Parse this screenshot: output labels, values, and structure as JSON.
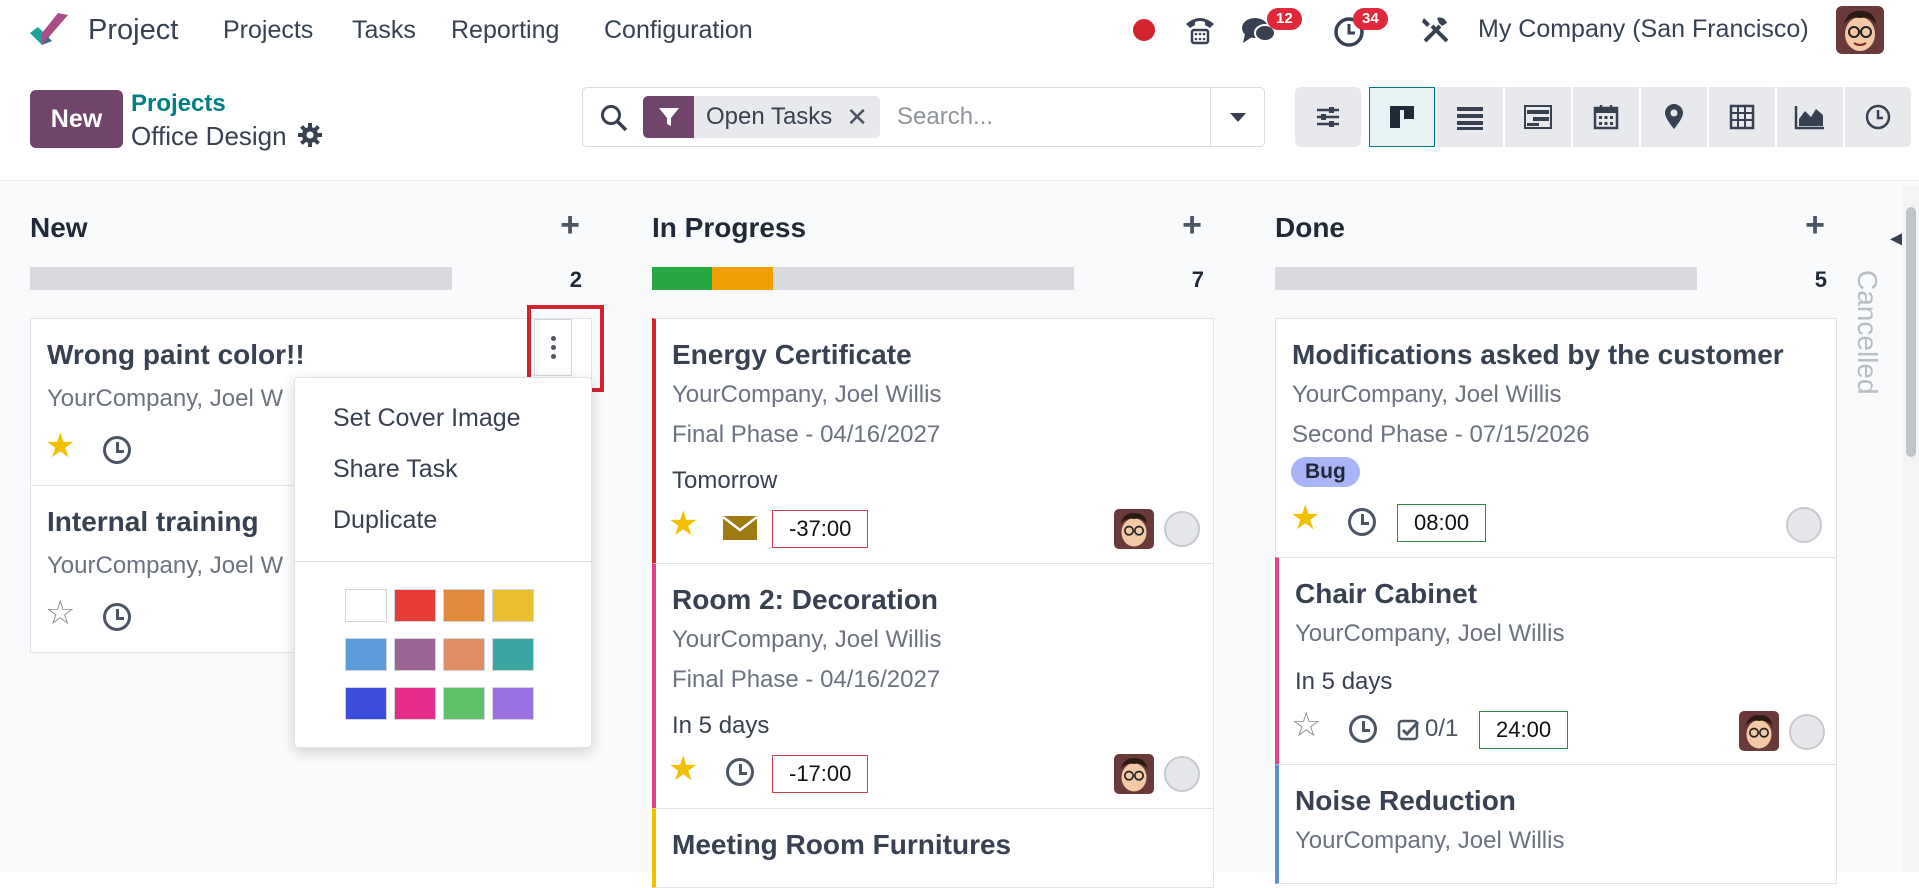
{
  "nav": {
    "app_title": "Project",
    "menus": [
      "Projects",
      "Tasks",
      "Reporting",
      "Configuration"
    ],
    "chat_badge": "12",
    "activity_badge": "34",
    "company": "My Company (San Francisco)"
  },
  "control": {
    "new_label": "New",
    "breadcrumb_parent": "Projects",
    "breadcrumb_current": "Office Design",
    "facet_label": "Open Tasks",
    "facet_remove": "✕",
    "search_placeholder": "Search..."
  },
  "views": [
    "kanban-icon",
    "list-icon",
    "gantt-icon",
    "calendar-icon",
    "map-icon",
    "pivot-icon",
    "graph-icon",
    "activity-icon"
  ],
  "columns": [
    {
      "title": "New",
      "add": "+",
      "count": "2",
      "cards": [
        {
          "title": "Wrong paint color!!",
          "sub": "YourCompany, Joel W",
          "starred": true
        },
        {
          "title": "Internal training",
          "sub": "YourCompany, Joel W",
          "starred": false
        }
      ]
    },
    {
      "title": "In Progress",
      "add": "+",
      "count": "7",
      "progress": [
        {
          "color": "#28a745",
          "fraction": 0.143
        },
        {
          "color": "#f0a000",
          "fraction": 0.143
        }
      ],
      "cards": [
        {
          "title": "Energy Certificate",
          "sub": "YourCompany, Joel Willis",
          "milestone": "Final Phase - 04/16/2027",
          "deadline": "Tomorrow",
          "starred": true,
          "hours": "-37:00",
          "border": "#d3232c"
        },
        {
          "title": "Room 2: Decoration",
          "sub": "YourCompany, Joel Willis",
          "milestone": "Final Phase - 04/16/2027",
          "deadline": "In 5 days",
          "starred": true,
          "hours": "-17:00",
          "border": "#e83e8c"
        },
        {
          "title": "Meeting Room Furnitures",
          "border": "#f3c000"
        }
      ]
    },
    {
      "title": "Done",
      "add": "+",
      "count": "5",
      "cards": [
        {
          "title": "Modifications asked by the customer",
          "sub": "YourCompany, Joel Willis",
          "milestone": "Second Phase - 07/15/2026",
          "tag": "Bug",
          "starred": true,
          "hours": "08:00"
        },
        {
          "title": "Chair Cabinet",
          "sub": "YourCompany, Joel Willis",
          "deadline": "In 5 days",
          "starred": false,
          "subtasks": "0/1",
          "hours": "24:00",
          "border": "#e83e8c"
        },
        {
          "title": "Noise Reduction",
          "sub": "YourCompany, Joel Willis",
          "border": "#5b8dd9"
        }
      ]
    }
  ],
  "dropdown": {
    "items": [
      "Set Cover Image",
      "Share Task",
      "Duplicate"
    ],
    "colors": [
      "#ffffff",
      "#e83a36",
      "#e08a3c",
      "#e9be2f",
      "#5b9bd9",
      "#9a6592",
      "#e08e68",
      "#3aa6a0",
      "#3b4ddb",
      "#e62b8a",
      "#5fc26b",
      "#9a70e0"
    ]
  },
  "folded_column": "Cancelled"
}
